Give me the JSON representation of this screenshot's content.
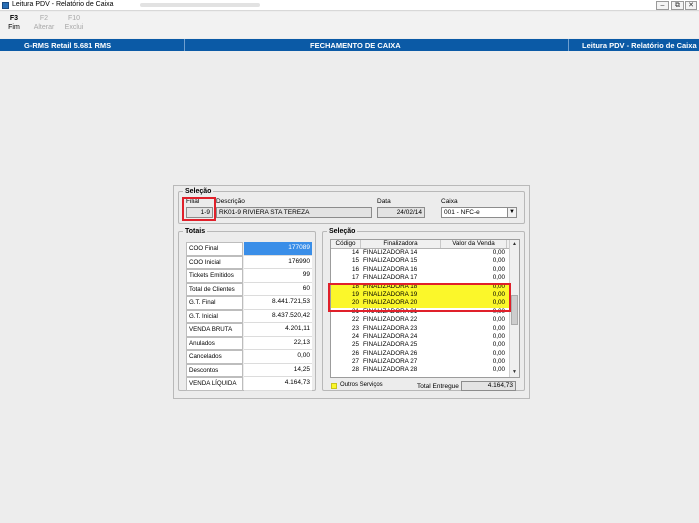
{
  "window": {
    "title": "Leitura PDV - Relatório de Caixa",
    "minimize": "–",
    "maximize": "⧉",
    "close": "✕"
  },
  "toolbar": {
    "buttons": [
      {
        "key": "F3",
        "label": "Fim",
        "enabled": true
      },
      {
        "key": "F2",
        "label": "Alterar",
        "enabled": false
      },
      {
        "key": "F10",
        "label": "Exclui",
        "enabled": false
      }
    ]
  },
  "header": {
    "left": "G-RMS Retail 5.681 RMS",
    "center": "FECHAMENTO DE CAIXA",
    "right": "Leitura PDV - Relatório de Caixa"
  },
  "selecao_top": {
    "legend": "Seleção",
    "filial_label": "Filial",
    "filial_value": "1-9",
    "descricao_label": "Descrição",
    "descricao_value": "RK01-9 RIVIERA STA TEREZA",
    "data_label": "Data",
    "data_value": "24/02/14",
    "caixa_label": "Caixa",
    "caixa_value": "001 - NFC-e"
  },
  "totais": {
    "legend": "Totais",
    "rows": [
      {
        "label": "COO Final",
        "value": "177089"
      },
      {
        "label": "COO Inicial",
        "value": "176990"
      },
      {
        "label": "Tickets Emitidos",
        "value": "99"
      },
      {
        "label": "Total de Clientes",
        "value": "60"
      },
      {
        "label": "G.T. Final",
        "value": "8.441.721,53"
      },
      {
        "label": "G.T. Inicial",
        "value": "8.437.520,42"
      },
      {
        "label": "VENDA BRUTA",
        "value": "4.201,11"
      },
      {
        "label": "Anulados",
        "value": "22,13"
      },
      {
        "label": "Cancelados",
        "value": "0,00"
      },
      {
        "label": "Descontos",
        "value": "14,25"
      },
      {
        "label": "VENDA LÍQUIDA",
        "value": "4.164,73"
      }
    ]
  },
  "selecao_grid": {
    "legend": "Seleção",
    "columns": [
      "Código",
      "Finalizadora",
      "Valor da Venda"
    ],
    "rows": [
      {
        "codigo": "14",
        "finalizadora": "FINALIZADORA 14",
        "valor": "0,00"
      },
      {
        "codigo": "15",
        "finalizadora": "FINALIZADORA 15",
        "valor": "0,00"
      },
      {
        "codigo": "16",
        "finalizadora": "FINALIZADORA 16",
        "valor": "0,00"
      },
      {
        "codigo": "17",
        "finalizadora": "FINALIZADORA 17",
        "valor": "0,00"
      },
      {
        "codigo": "18",
        "finalizadora": "FINALIZADORA 18",
        "valor": "0,00",
        "highlight": true
      },
      {
        "codigo": "19",
        "finalizadora": "FINALIZADORA 19",
        "valor": "0,00",
        "highlight": true
      },
      {
        "codigo": "20",
        "finalizadora": "FINALIZADORA 20",
        "valor": "0,00",
        "highlight": true
      },
      {
        "codigo": "21",
        "finalizadora": "FINALIZADORA 21",
        "valor": "0,00"
      },
      {
        "codigo": "22",
        "finalizadora": "FINALIZADORA 22",
        "valor": "0,00"
      },
      {
        "codigo": "23",
        "finalizadora": "FINALIZADORA 23",
        "valor": "0,00"
      },
      {
        "codigo": "24",
        "finalizadora": "FINALIZADORA 24",
        "valor": "0,00"
      },
      {
        "codigo": "25",
        "finalizadora": "FINALIZADORA 25",
        "valor": "0,00"
      },
      {
        "codigo": "26",
        "finalizadora": "FINALIZADORA 26",
        "valor": "0,00"
      },
      {
        "codigo": "27",
        "finalizadora": "FINALIZADORA 27",
        "valor": "0,00"
      },
      {
        "codigo": "28",
        "finalizadora": "FINALIZADORA 28",
        "valor": "0,00"
      }
    ],
    "legend_note": "Outros Serviços",
    "total_label": "Total Entregue",
    "total_value": "4.164,73"
  },
  "colors": {
    "header_blue": "#0b5aa6",
    "highlight_yellow": "#fbf72a",
    "selected_blue": "#3a8ee8",
    "annotation_red": "#e0202a"
  }
}
